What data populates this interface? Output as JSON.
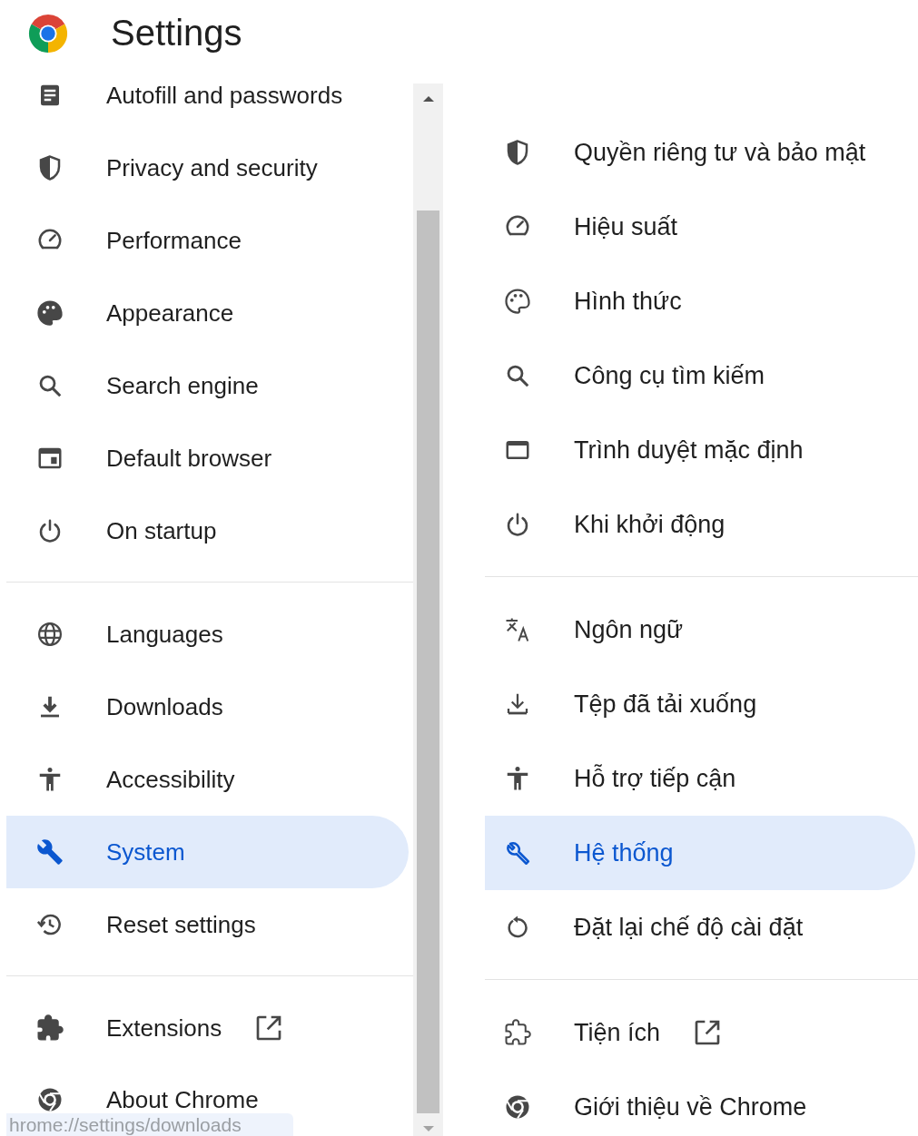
{
  "left_panel": {
    "title": "Settings",
    "groups": [
      {
        "items": [
          {
            "kind": "autofill",
            "label": "Autofill and passwords",
            "selected": false,
            "external": false
          },
          {
            "kind": "privacy",
            "label": "Privacy and security",
            "selected": false,
            "external": false
          },
          {
            "kind": "performance",
            "label": "Performance",
            "selected": false,
            "external": false
          },
          {
            "kind": "appearance",
            "label": "Appearance",
            "selected": false,
            "external": false
          },
          {
            "kind": "search",
            "label": "Search engine",
            "selected": false,
            "external": false
          },
          {
            "kind": "browser",
            "label": "Default browser",
            "selected": false,
            "external": false
          },
          {
            "kind": "startup",
            "label": "On startup",
            "selected": false,
            "external": false
          }
        ]
      },
      {
        "items": [
          {
            "kind": "globe",
            "label": "Languages",
            "selected": false,
            "external": false
          },
          {
            "kind": "downloads",
            "label": "Downloads",
            "selected": false,
            "external": false
          },
          {
            "kind": "accessibility",
            "label": "Accessibility",
            "selected": false,
            "external": false
          },
          {
            "kind": "system",
            "label": "System",
            "selected": true,
            "external": false
          },
          {
            "kind": "history",
            "label": "Reset settings",
            "selected": false,
            "external": false
          }
        ]
      },
      {
        "items": [
          {
            "kind": "extensions",
            "label": "Extensions",
            "selected": false,
            "external": true
          },
          {
            "kind": "about",
            "label": "About Chrome",
            "selected": false,
            "external": false
          }
        ]
      }
    ]
  },
  "right_panel": {
    "groups": [
      {
        "items": [
          {
            "kind": "privacy",
            "label": "Quyền riêng tư và bảo mật",
            "selected": false,
            "external": false
          },
          {
            "kind": "performance",
            "label": "Hiệu suất",
            "selected": false,
            "external": false
          },
          {
            "kind": "appearance",
            "label": "Hình thức",
            "selected": false,
            "external": false
          },
          {
            "kind": "search",
            "label": "Công cụ tìm kiếm",
            "selected": false,
            "external": false
          },
          {
            "kind": "window",
            "label": "Trình duyệt mặc định",
            "selected": false,
            "external": false
          },
          {
            "kind": "startup",
            "label": "Khi khởi động",
            "selected": false,
            "external": false
          }
        ]
      },
      {
        "items": [
          {
            "kind": "translate",
            "label": "Ngôn ngữ",
            "selected": false,
            "external": false
          },
          {
            "kind": "downloads",
            "label": "Tệp đã tải xuống",
            "selected": false,
            "external": false
          },
          {
            "kind": "accessibility",
            "label": "Hỗ trợ tiếp cận",
            "selected": false,
            "external": false
          },
          {
            "kind": "system",
            "label": "Hệ thống",
            "selected": true,
            "external": false
          },
          {
            "kind": "reset",
            "label": "Đặt lại chế độ cài đặt",
            "selected": false,
            "external": false
          }
        ]
      },
      {
        "items": [
          {
            "kind": "extensions",
            "label": "Tiện ích",
            "selected": false,
            "external": true
          },
          {
            "kind": "about",
            "label": "Giới thiệu về Chrome",
            "selected": false,
            "external": false
          }
        ]
      }
    ]
  },
  "status_bar": {
    "url": "hrome://settings/downloads"
  }
}
